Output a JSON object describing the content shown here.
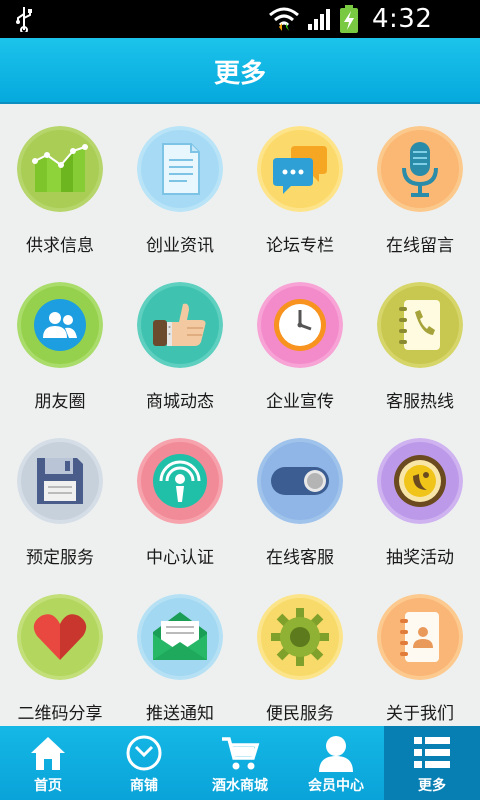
{
  "status_bar": {
    "time": "4:32 PM"
  },
  "header": {
    "title": "更多"
  },
  "grid": {
    "items": [
      {
        "label": "供求信息",
        "icon": "bar-chart-icon"
      },
      {
        "label": "创业资讯",
        "icon": "document-icon"
      },
      {
        "label": "论坛专栏",
        "icon": "chat-bubbles-icon"
      },
      {
        "label": "在线留言",
        "icon": "microphone-icon"
      },
      {
        "label": "朋友圈",
        "icon": "people-icon"
      },
      {
        "label": "商城动态",
        "icon": "thumbs-up-icon"
      },
      {
        "label": "企业宣传",
        "icon": "clock-icon"
      },
      {
        "label": "客服热线",
        "icon": "phone-book-icon"
      },
      {
        "label": "预定服务",
        "icon": "floppy-disk-icon"
      },
      {
        "label": "中心认证",
        "icon": "certification-icon"
      },
      {
        "label": "在线客服",
        "icon": "toggle-switch-icon"
      },
      {
        "label": "抽奖活动",
        "icon": "lottery-icon"
      },
      {
        "label": "二维码分享",
        "icon": "heart-icon"
      },
      {
        "label": "推送通知",
        "icon": "envelope-icon"
      },
      {
        "label": "便民服务",
        "icon": "gear-icon"
      },
      {
        "label": "关于我们",
        "icon": "contact-book-icon"
      }
    ]
  },
  "tab_bar": {
    "tabs": [
      {
        "label": "首页",
        "icon": "home-icon"
      },
      {
        "label": "商铺",
        "icon": "clock-icon"
      },
      {
        "label": "酒水商城",
        "icon": "cart-icon"
      },
      {
        "label": "会员中心",
        "icon": "user-icon"
      },
      {
        "label": "更多",
        "icon": "list-icon",
        "active": true
      }
    ]
  },
  "colors": {
    "accent": "#0aa9de",
    "active_tab": "#077fb3",
    "background": "#eef0ef"
  }
}
